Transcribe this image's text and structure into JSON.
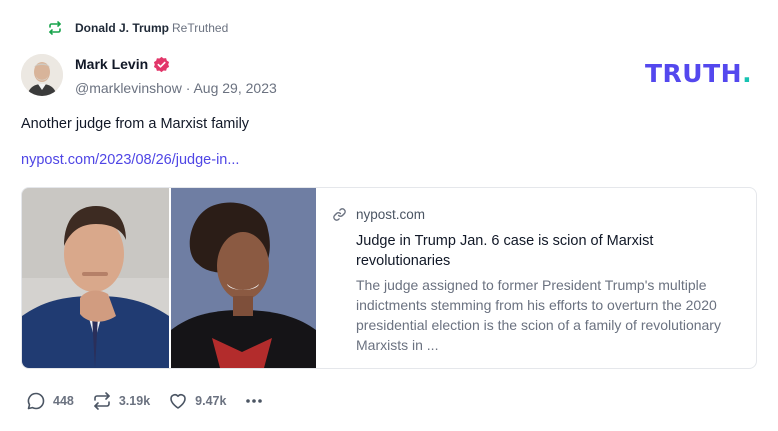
{
  "retruth": {
    "user": "Donald J. Trump",
    "label": "ReTruthed"
  },
  "author": {
    "name": "Mark Levin",
    "handle_date": "@marklevinshow · Aug 29, 2023"
  },
  "logo": {
    "text": "TRUTH",
    "dot": ".",
    "brand_color": "#5448ee",
    "dot_color": "#17c3b2"
  },
  "post": {
    "text": "Another judge from a Marxist family",
    "link": "nypost.com/2023/08/26/judge-in..."
  },
  "card": {
    "domain": "nypost.com",
    "title": "Judge in Trump Jan. 6 case is scion of Marxist revolutionaries",
    "description": "The judge assigned to former President Trump's multiple indictments stemming from his efforts to overturn the 2020 presidential election is the scion of a family of revolutionary Marxists in ..."
  },
  "actions": {
    "replies": "448",
    "retruths": "3.19k",
    "likes": "9.47k"
  },
  "icons": {
    "retruth": "retruth-icon",
    "verified": "verified-badge-icon",
    "link": "link-icon",
    "reply": "reply-icon",
    "like": "heart-icon",
    "more": "more-icon"
  }
}
